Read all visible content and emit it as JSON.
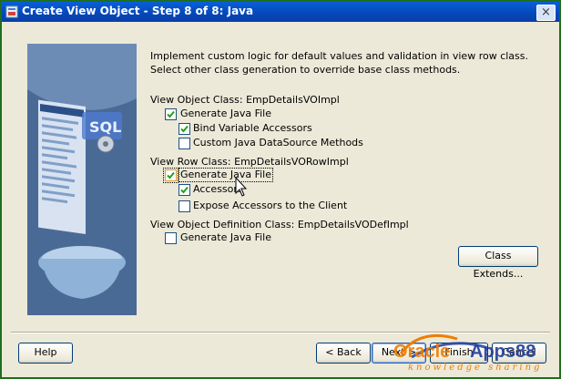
{
  "window": {
    "title": "Create View Object - Step 8 of 8: Java",
    "close_glyph": "×"
  },
  "description": "Implement custom logic for default values and validation in view row class.  Select other class generation to override base class methods.",
  "view_object_class": {
    "label": "View Object Class: EmpDetailsVOImpl",
    "generate": {
      "label": "Generate Java File",
      "checked": true
    },
    "bind_vars": {
      "label": "Bind Variable Accessors",
      "checked": true
    },
    "custom_ds": {
      "label": "Custom Java DataSource Methods",
      "checked": false
    }
  },
  "view_row_class": {
    "label": "View Row Class: EmpDetailsVORowImpl",
    "generate": {
      "label": "Generate Java File",
      "checked": true
    },
    "accessors": {
      "label": "Accessors",
      "checked": true
    },
    "expose": {
      "label": "Expose Accessors to the Client",
      "checked": false
    }
  },
  "view_def_class": {
    "label": "View Object Definition Class: EmpDetailsVODefImpl",
    "generate": {
      "label": "Generate Java File",
      "checked": false
    }
  },
  "buttons": {
    "class_extends": "Class Extends...",
    "help": "Help",
    "back": "< Back",
    "next": "Next >",
    "finish": "Finish",
    "cancel": "Cancel"
  },
  "watermark": {
    "brand_oracle": "Oracle",
    "brand_apps": "Apps88",
    "tagline": "knowledge sharing"
  },
  "art": {
    "sql_text": "SQL"
  },
  "colors": {
    "title_blue": "#0547b8",
    "frame_green": "#1e6e1e",
    "checkbox_border": "#1c5180",
    "check_green": "#21a121",
    "watermark_orange": "#f07d00",
    "watermark_blue": "#1f3d9c"
  }
}
